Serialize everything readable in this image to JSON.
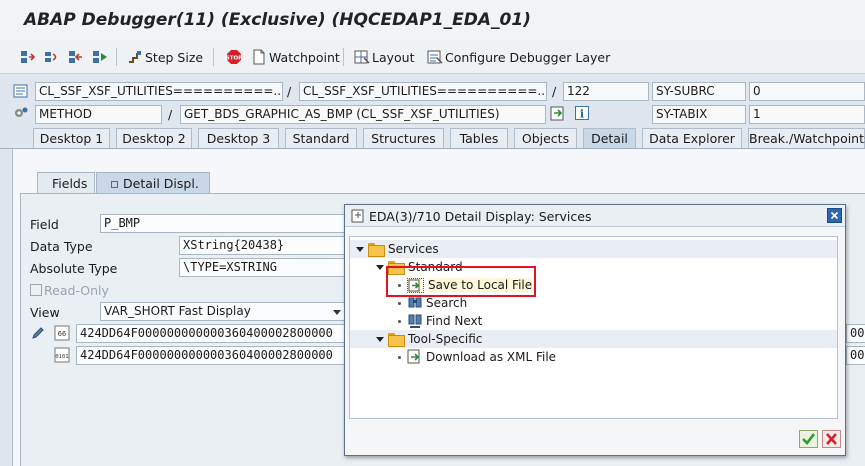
{
  "window": {
    "title": "ABAP Debugger(11)  (Exclusive) (HQCEDAP1_EDA_01)"
  },
  "toolbar": {
    "step_size": "Step Size",
    "watchpoint": "Watchpoint",
    "layout": "Layout",
    "configure": "Configure Debugger Layer"
  },
  "info": {
    "row1": {
      "program": "CL_SSF_XSF_UTILITIES==========...",
      "include": "CL_SSF_XSF_UTILITIES==========...",
      "line": "122",
      "sysvar_label": "SY-SUBRC",
      "sysvar_value": "0"
    },
    "row2": {
      "type": "METHOD",
      "name": "GET_BDS_GRAPHIC_AS_BMP (CL_SSF_XSF_UTILITIES)",
      "sysvar_label": "SY-TABIX",
      "sysvar_value": "1"
    },
    "slash": "/"
  },
  "tabs": [
    "Desktop 1",
    "Desktop 2",
    "Desktop 3",
    "Standard",
    "Structures",
    "Tables",
    "Objects",
    "Detail",
    "Data Explorer",
    "Break./Watchpoints"
  ],
  "subtabs": {
    "fields": "Fields",
    "detail": "Detail Displ."
  },
  "detail": {
    "field_label": "Field",
    "field_value": "P_BMP",
    "datatype_label": "Data Type",
    "datatype_value": "XString{20438}",
    "abstype_label": "Absolute Type",
    "abstype_value": "\\TYPE=XSTRING",
    "readonly_label": "Read-Only",
    "view_label": "View",
    "view_value": "VAR_SHORT Fast Display",
    "hex1": "424DD64F000000000000360400002800000",
    "hex2": "424DD64F000000000000360400002800000",
    "right1": "00",
    "right2": "00"
  },
  "dialog": {
    "title": "EDA(3)/710 Detail Display: Services",
    "tree": {
      "services": "Services",
      "standard": "Standard",
      "save_local": "Save to Local File",
      "search": "Search",
      "find_next": "Find Next",
      "tool_specific": "Tool-Specific",
      "download_xml": "Download as XML File"
    }
  },
  "colors": {
    "highlight_border": "#e0141c",
    "accent_blue": "#1f5fa8"
  }
}
